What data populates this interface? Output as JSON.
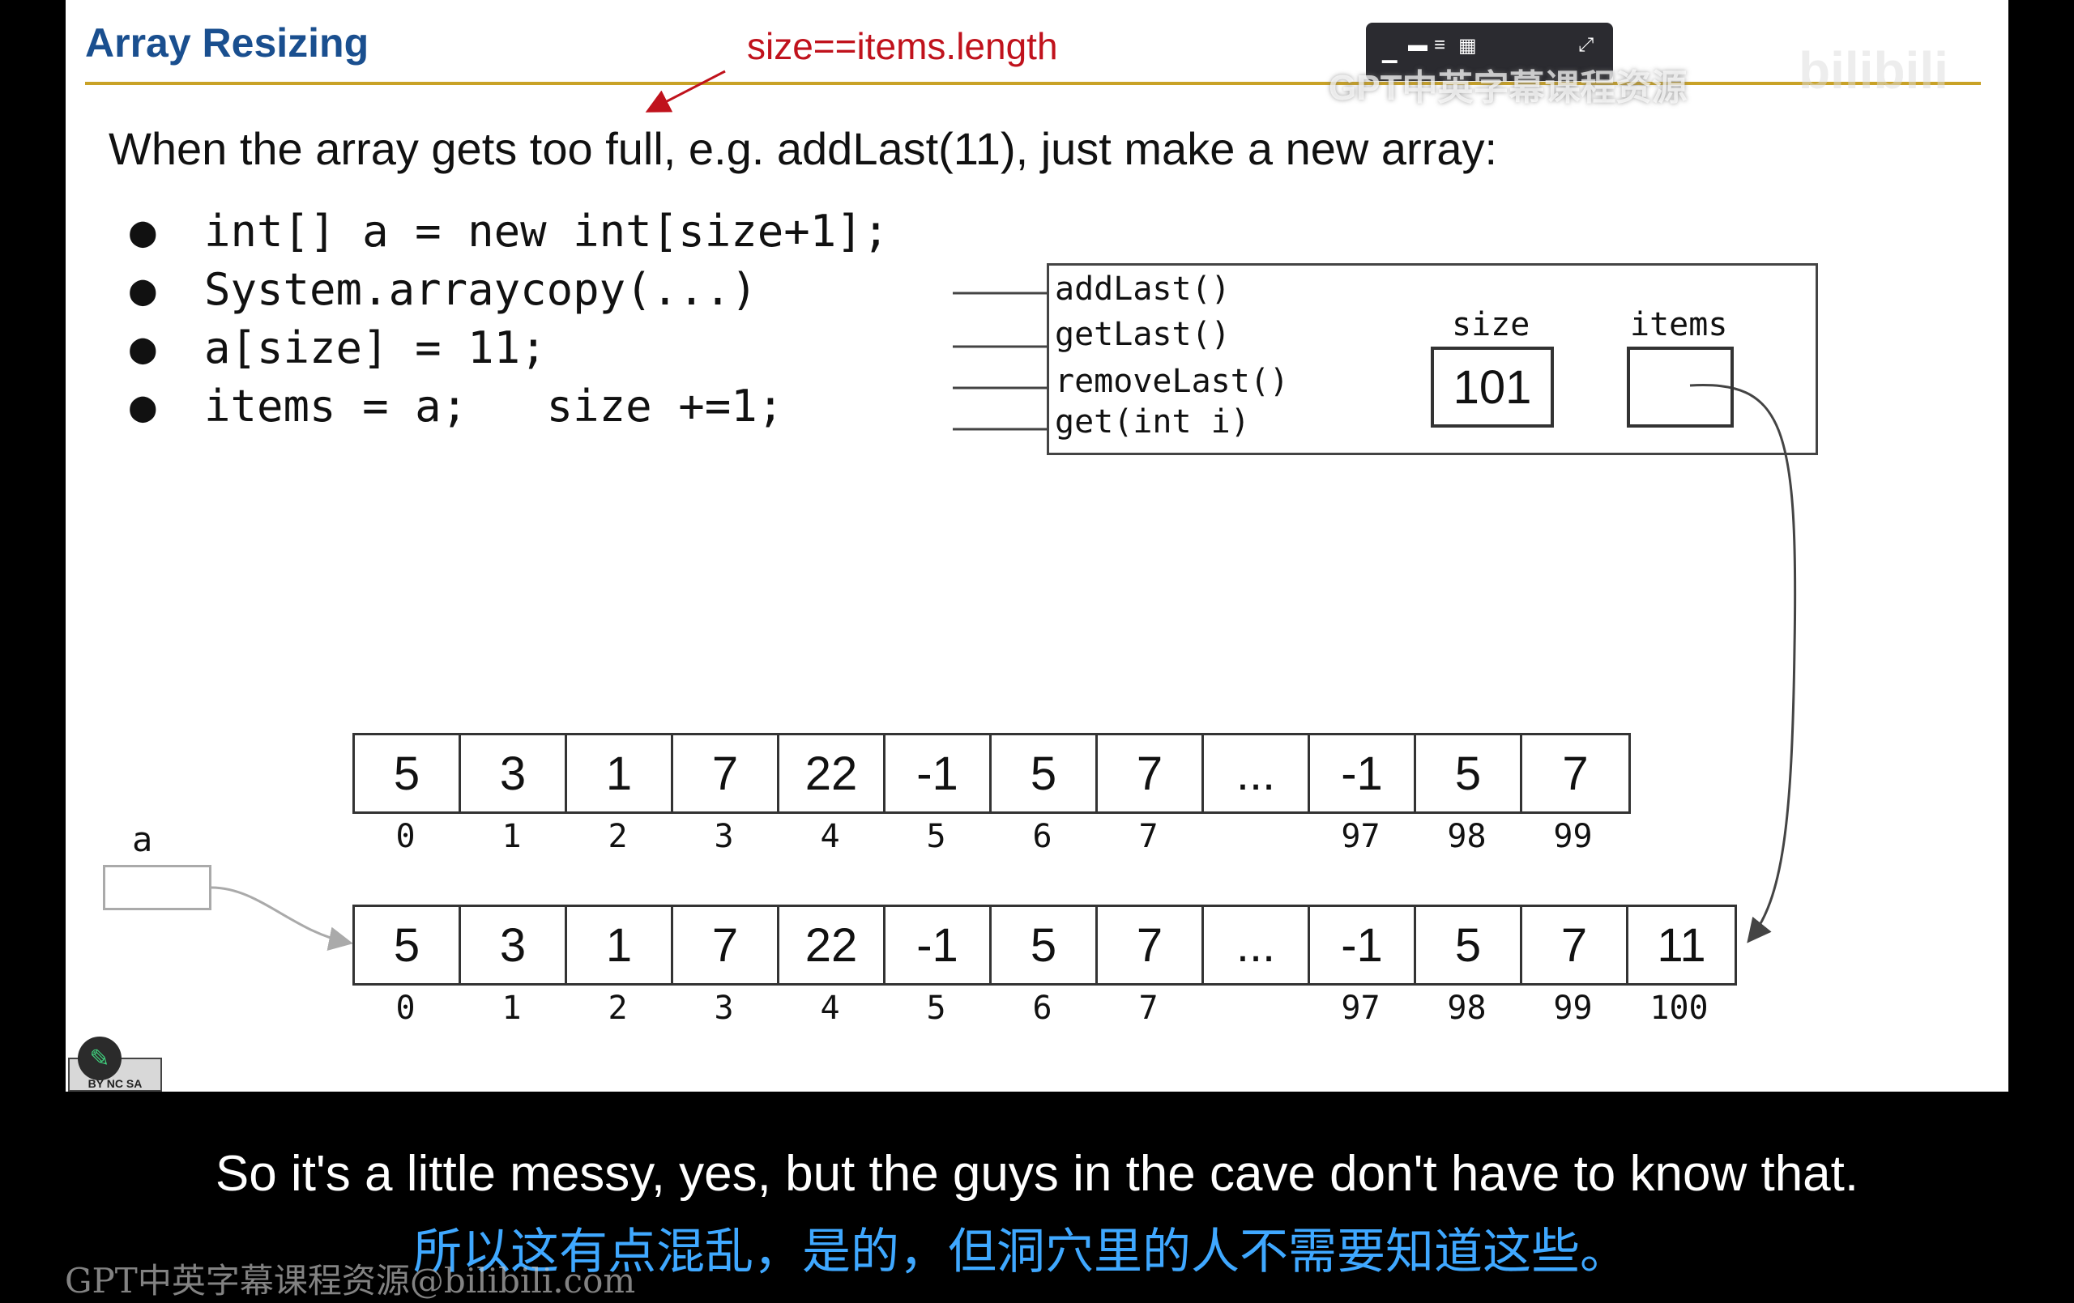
{
  "slide": {
    "title": "Array Resizing",
    "annotation": "size==items.length",
    "intro": "When the array gets too full, e.g. addLast(11), just make a new array:",
    "bullets": [
      "int[] a = new int[size+1];",
      "System.arraycopy(...)",
      "a[size] = 11;",
      "items = a;   size +=1;"
    ],
    "object": {
      "methods": [
        "addLast()",
        "getLast()",
        "removeLast()",
        "get(int i)"
      ],
      "size_label": "size",
      "size_value": "101",
      "items_label": "items"
    },
    "old_array": {
      "values": [
        "5",
        "3",
        "1",
        "7",
        "22",
        "-1",
        "5",
        "7",
        "...",
        "-1",
        "5",
        "7"
      ],
      "indices": [
        "0",
        "1",
        "2",
        "3",
        "4",
        "5",
        "6",
        "7",
        "",
        "97",
        "98",
        "99"
      ]
    },
    "new_array": {
      "values": [
        "5",
        "3",
        "1",
        "7",
        "22",
        "-1",
        "5",
        "7",
        "...",
        "-1",
        "5",
        "7",
        "11"
      ],
      "indices": [
        "0",
        "1",
        "2",
        "3",
        "4",
        "5",
        "6",
        "7",
        "",
        "97",
        "98",
        "99",
        "100"
      ]
    },
    "var_label": "a"
  },
  "overlay": {
    "watermark": "GPT中英字幕课程资源",
    "brand": "bilibili",
    "icons": [
      "minimize-icon",
      "layout-icon",
      "grid-icon",
      "expand-icon"
    ],
    "license": "BY NC SA"
  },
  "subtitles": {
    "english": "So it's a little messy, yes, but the guys in the cave don't have to know that.",
    "chinese": "所以这有点混乱，是的，但洞穴里的人不需要知道这些。",
    "watermark": "GPT中英字幕课程资源@bilibili.com"
  },
  "colors": {
    "title": "#1a4f8f",
    "rule": "#c9a227",
    "annotation": "#c0121c",
    "chinese_subtitle": "#3fa8ff"
  }
}
